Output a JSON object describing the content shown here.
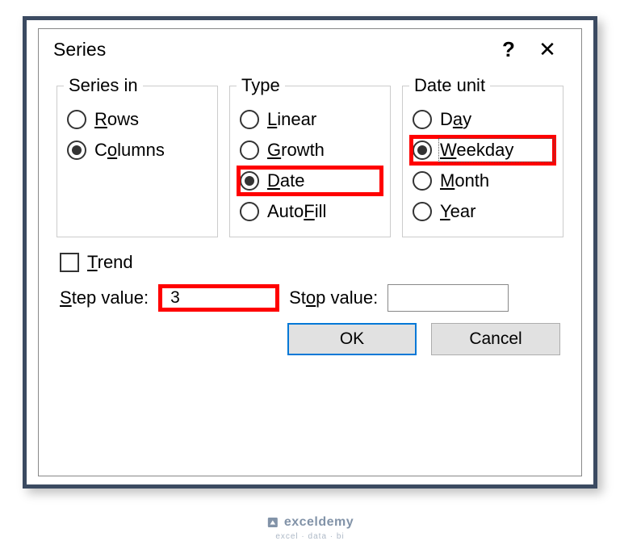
{
  "dialog": {
    "title": "Series",
    "help_symbol": "?",
    "close_symbol": "✕"
  },
  "groups": {
    "series_in": {
      "legend": "Series in",
      "options": {
        "rows": {
          "label_pre": "",
          "label_u": "R",
          "label_post": "ows",
          "checked": false
        },
        "columns": {
          "label_pre": "C",
          "label_u": "o",
          "label_post": "lumns",
          "checked": true
        }
      }
    },
    "type": {
      "legend": "Type",
      "options": {
        "linear": {
          "label_pre": "",
          "label_u": "L",
          "label_post": "inear",
          "checked": false
        },
        "growth": {
          "label_pre": "",
          "label_u": "G",
          "label_post": "rowth",
          "checked": false
        },
        "date": {
          "label_pre": "",
          "label_u": "D",
          "label_post": "ate",
          "checked": true,
          "highlighted": true
        },
        "autofill": {
          "label_pre": "Auto",
          "label_u": "F",
          "label_post": "ill",
          "checked": false
        }
      }
    },
    "date_unit": {
      "legend": "Date unit",
      "options": {
        "day": {
          "label_pre": "D",
          "label_u": "a",
          "label_post": "y",
          "checked": false
        },
        "weekday": {
          "label_pre": "",
          "label_u": "W",
          "label_post": "eekday",
          "checked": true,
          "highlighted": true
        },
        "month": {
          "label_pre": "",
          "label_u": "M",
          "label_post": "onth",
          "checked": false
        },
        "year": {
          "label_pre": "",
          "label_u": "Y",
          "label_post": "ear",
          "checked": false
        }
      }
    }
  },
  "trend": {
    "label_pre": "",
    "label_u": "T",
    "label_post": "rend",
    "checked": false
  },
  "values": {
    "step": {
      "label_pre": "",
      "label_u": "S",
      "label_post": "tep value:",
      "value": "3",
      "highlighted": true
    },
    "stop": {
      "label_pre": "St",
      "label_u": "o",
      "label_post": "p value:",
      "value": ""
    }
  },
  "buttons": {
    "ok": "OK",
    "cancel": "Cancel"
  },
  "watermark": {
    "brand": "exceldemy",
    "tagline": "excel · data · bi"
  }
}
